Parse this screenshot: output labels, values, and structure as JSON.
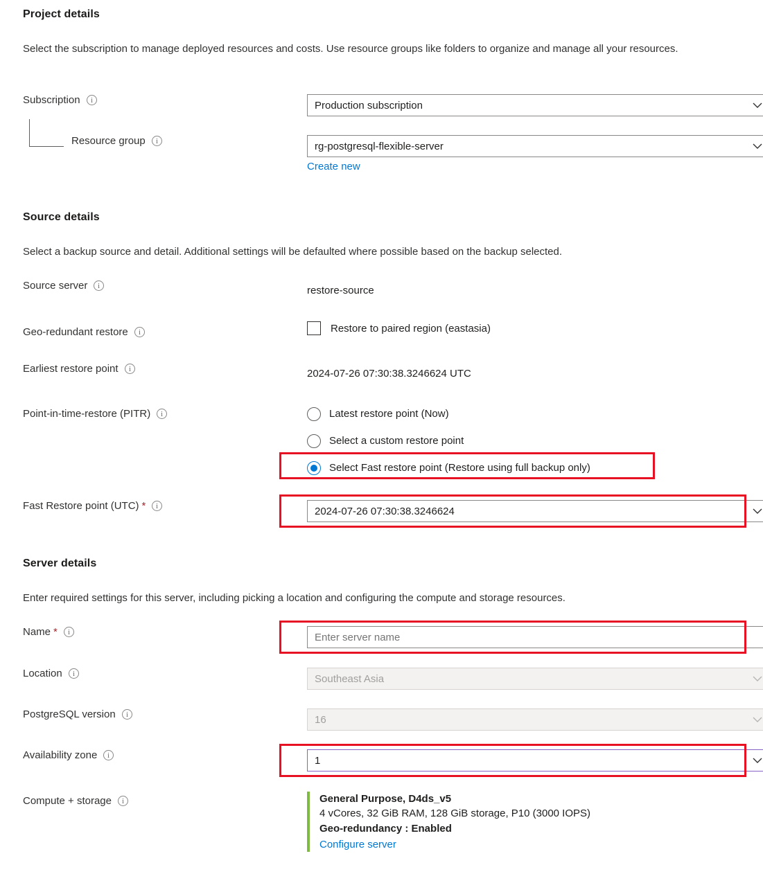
{
  "project_details": {
    "heading": "Project details",
    "description": "Select the subscription to manage deployed resources and costs. Use resource groups like folders to organize and manage all your resources.",
    "subscription": {
      "label": "Subscription",
      "value": "Production subscription"
    },
    "resource_group": {
      "label": "Resource group",
      "value": "rg-postgresql-flexible-server",
      "create_new_link": "Create new"
    }
  },
  "source_details": {
    "heading": "Source details",
    "description": "Select a backup source and detail. Additional settings will be defaulted where possible based on the backup selected.",
    "source_server": {
      "label": "Source server",
      "value": "restore-source"
    },
    "geo_redundant_restore": {
      "label": "Geo-redundant restore",
      "checkbox_label": "Restore to paired region (eastasia)",
      "checked": false
    },
    "earliest_restore_point": {
      "label": "Earliest restore point",
      "value": "2024-07-26 07:30:38.3246624 UTC"
    },
    "pitr": {
      "label": "Point-in-time-restore (PITR)",
      "options": [
        {
          "label": "Latest restore point (Now)",
          "selected": false
        },
        {
          "label": "Select a custom restore point",
          "selected": false
        },
        {
          "label": "Select Fast restore point (Restore using full backup only)",
          "selected": true
        }
      ]
    },
    "fast_restore_point": {
      "label": "Fast Restore point (UTC)",
      "required": true,
      "value": "2024-07-26 07:30:38.3246624"
    }
  },
  "server_details": {
    "heading": "Server details",
    "description": "Enter required settings for this server, including picking a location and configuring the compute and storage resources.",
    "name": {
      "label": "Name",
      "required": true,
      "value": "",
      "placeholder": "Enter server name"
    },
    "location": {
      "label": "Location",
      "value": "Southeast Asia",
      "disabled": true
    },
    "postgresql_version": {
      "label": "PostgreSQL version",
      "value": "16",
      "disabled": true
    },
    "availability_zone": {
      "label": "Availability zone",
      "value": "1"
    },
    "compute_storage": {
      "label": "Compute + storage",
      "tier": "General Purpose, D4ds_v5",
      "specs": "4 vCores, 32 GiB RAM, 128 GiB storage, P10 (3000 IOPS)",
      "geo_redundancy": "Geo-redundancy : Enabled",
      "configure_link": "Configure server"
    }
  },
  "colors": {
    "accent_blue": "#0078d4",
    "highlight_red": "#e81123",
    "required_red": "#a4262c",
    "focus_purple": "#8661c5",
    "compute_green": "#7fba42"
  }
}
